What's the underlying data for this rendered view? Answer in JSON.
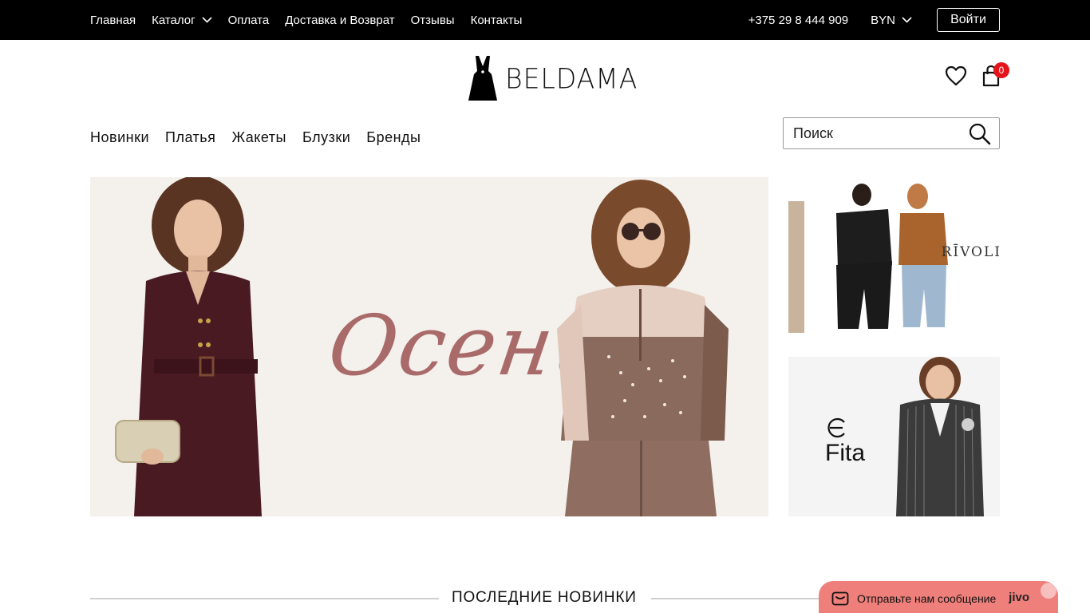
{
  "topbar": {
    "nav": [
      "Главная",
      "Каталог",
      "Оплата",
      "Доставка и Возврат",
      "Отзывы",
      "Контакты"
    ],
    "phone": "+375 29 8 444 909",
    "currency": "BYN",
    "login_label": "Войти"
  },
  "header": {
    "logo_text": "BELDAMA",
    "cart_count": "0"
  },
  "main_nav": [
    "Новинки",
    "Платья",
    "Жакеты",
    "Блузки",
    "Бренды"
  ],
  "search": {
    "placeholder": "Поиск"
  },
  "hero": {
    "word": "Осень"
  },
  "banners": {
    "rivoli": "RĪVOLI",
    "fita": "Fita"
  },
  "section": {
    "title": "ПОСЛЕДНИЕ НОВИНКИ"
  },
  "chat": {
    "label": "Отправьте нам сообщение",
    "brand": "jivo"
  },
  "colors": {
    "topbar": "#000000",
    "badge": "#e5141a",
    "chat": "#ee7f7a",
    "dress": "#4a1a23",
    "hero_word": "#a96a6a"
  }
}
